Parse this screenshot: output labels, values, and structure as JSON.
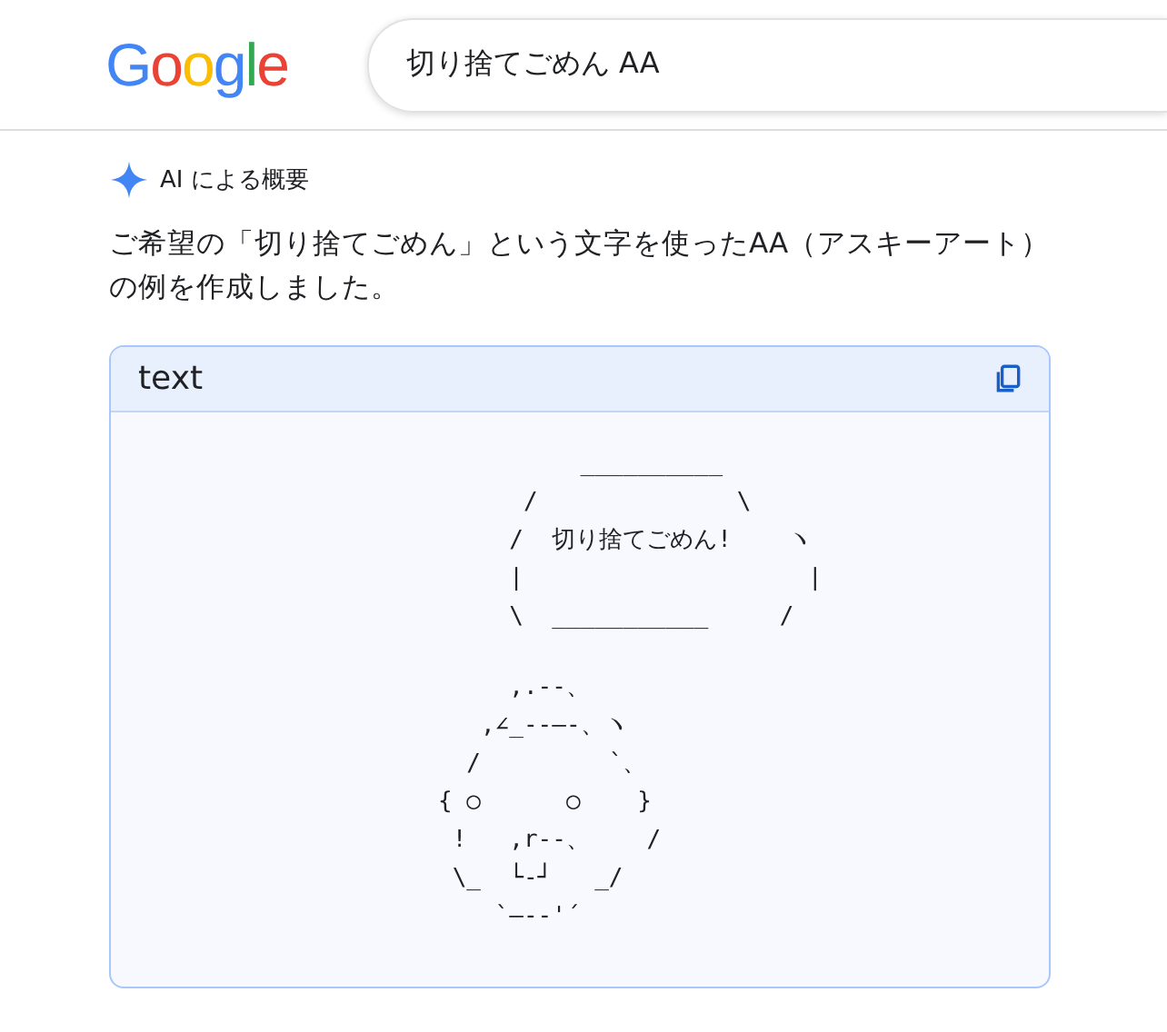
{
  "header": {
    "logo": "Google",
    "search_query": "切り捨てごめん AA"
  },
  "ai_overview": {
    "label": "AI による概要",
    "intro": "ご希望の「切り捨てごめん」という文字を使ったAA（アスキーアート）の例を作成しました。"
  },
  "code_block": {
    "language": "text",
    "balloon_lines": [
      "          __________",
      "      /              \\",
      "     /  切り捨てごめん!    ヽ",
      "     |                    |",
      "     \\  ___________     /"
    ],
    "face_lines": [
      "     ,.--、",
      "   ,∠_--―-、ヽ",
      "  /         `、",
      "{ ○      ○    }",
      " !   ,r--、    /",
      " \\_  └-┘   _/",
      "    `―-‐'´"
    ]
  }
}
